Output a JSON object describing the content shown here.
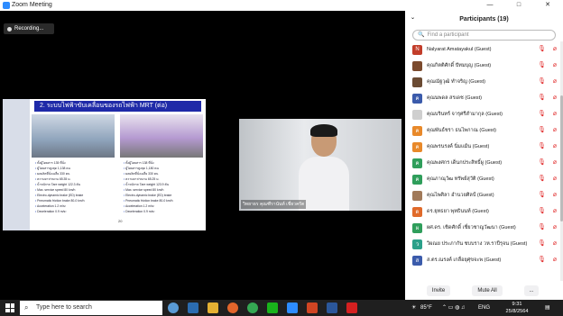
{
  "window": {
    "title": "Zoom Meeting",
    "controls": [
      "—",
      "□",
      "✕"
    ]
  },
  "recording": {
    "label": "Recording..."
  },
  "slide": {
    "title": "2. ระบบไฟฟ้าขับเคลื่อนของรถไฟฟ้า MRT (ต่อ)",
    "page_number": "20",
    "left_specs": [
      "ทั้งผู้โดยสาร 135 ที่นั่ง",
      "ผู้โดยสารสูงสุด 1,138 คน",
      "ผลผลิตที่นั่งเฉลี่ย 330 คน",
      "ความยาว/ขบวน 65.35 ม.",
      "น้ำหนักรถ Tare weight 122.3 ตัน",
      "Max. service speed 80 km/h",
      "Electro-dynamic brake (ED) brake",
      "Pneumatic friction brake 80-0 km/h",
      "Acceleration 1.2 m/s²",
      "Deceleration 0.9 m/s²"
    ],
    "right_specs": [
      "ทั้งผู้โดยสาร 138 ที่นั่ง",
      "ผู้โดยสารสูงสุด 1,180 คน",
      "ผลผลิตที่นั่งเฉลี่ย 330 คน",
      "ความยาว/ขบวน 65.25 ม.",
      "น้ำหนักรถ Tare weight 123.9 ตัน",
      "Max. service speed 80 km/h",
      "Electro-dynamic brake (ED) brake",
      "Pneumatic friction brake 80-0 km/h",
      "Acceleration 1.2 m/s²",
      "Deceleration 0.9 m/s²"
    ]
  },
  "speaker": {
    "name": "วิทยาธร คุณฑีรานันท์ เชี่ยวครัต"
  },
  "participants": {
    "header": "Participants (19)",
    "search_placeholder": "Find a participant",
    "items": [
      {
        "name": "Nalyarat Amatayakul (Guest)",
        "initial": "N",
        "color": "#c23d2a"
      },
      {
        "name": "คุณกิตติศักดิ์ ปัทมบุญ (Guest)",
        "initial": "",
        "color": "#7b4a2d"
      },
      {
        "name": "คุณณัฐวุฒิ ทำจริญ (Guest)",
        "initial": "",
        "color": "#6b4b33"
      },
      {
        "name": "คุณนพดล สรเดช (Guest)",
        "initial": "ค",
        "color": "#3b5bab"
      },
      {
        "name": "คุณบรินทร์ จารุศรีสำมากุล (Guest)",
        "initial": "",
        "color": "#cfcfcf"
      },
      {
        "name": "คุณพันธ์ชรา ธนไพกาณ (Guest)",
        "initial": "ค",
        "color": "#e8892a"
      },
      {
        "name": "คุณพรนรงค์ นิ่มแม้น (Guest)",
        "initial": "ค",
        "color": "#e8892a"
      },
      {
        "name": "คุณพงศกร เด็นกประสิทธิ์ผู (Guest)",
        "initial": "ค",
        "color": "#2f9e5b"
      },
      {
        "name": "คุณภาณุวัฒ ทรัพย์สุวัติ (Guest)",
        "initial": "ค",
        "color": "#2f9e5b"
      },
      {
        "name": "คุณไพศิลา อำนวยศิลป์ (Guest)",
        "initial": "",
        "color": "#a17a5a"
      },
      {
        "name": "ดร.ยุทธยา พุทธินนท์ (Guest)",
        "initial": "ด",
        "color": "#e06a2a"
      },
      {
        "name": "ผศ.ดร. เชิดศักดิ์ เชี่ยวชาญวัฒนา (Guest)",
        "initial": "ผ",
        "color": "#2f9e5b"
      },
      {
        "name": "วิผณย ประภากัน ชบบราง วห.ราปีรุจน (Guest)",
        "initial": "ว",
        "color": "#2aa08a"
      },
      {
        "name": "ส.ตร.ณรงค์ เกลื่อยุศุขจะพ (Guest)",
        "initial": "ส",
        "color": "#3b5bab"
      }
    ],
    "invite_label": "Invite",
    "mute_all_label": "Mute All",
    "more_label": "..."
  },
  "taskbar": {
    "search_placeholder": "Type here to search",
    "weather": "85°F",
    "language": "ENG",
    "time": "9:31",
    "date": "25/8/2564"
  },
  "colors": {
    "accent": "#2d8cff",
    "muted_red": "#e02828",
    "slide_title_bg": "#1f2aa8"
  }
}
